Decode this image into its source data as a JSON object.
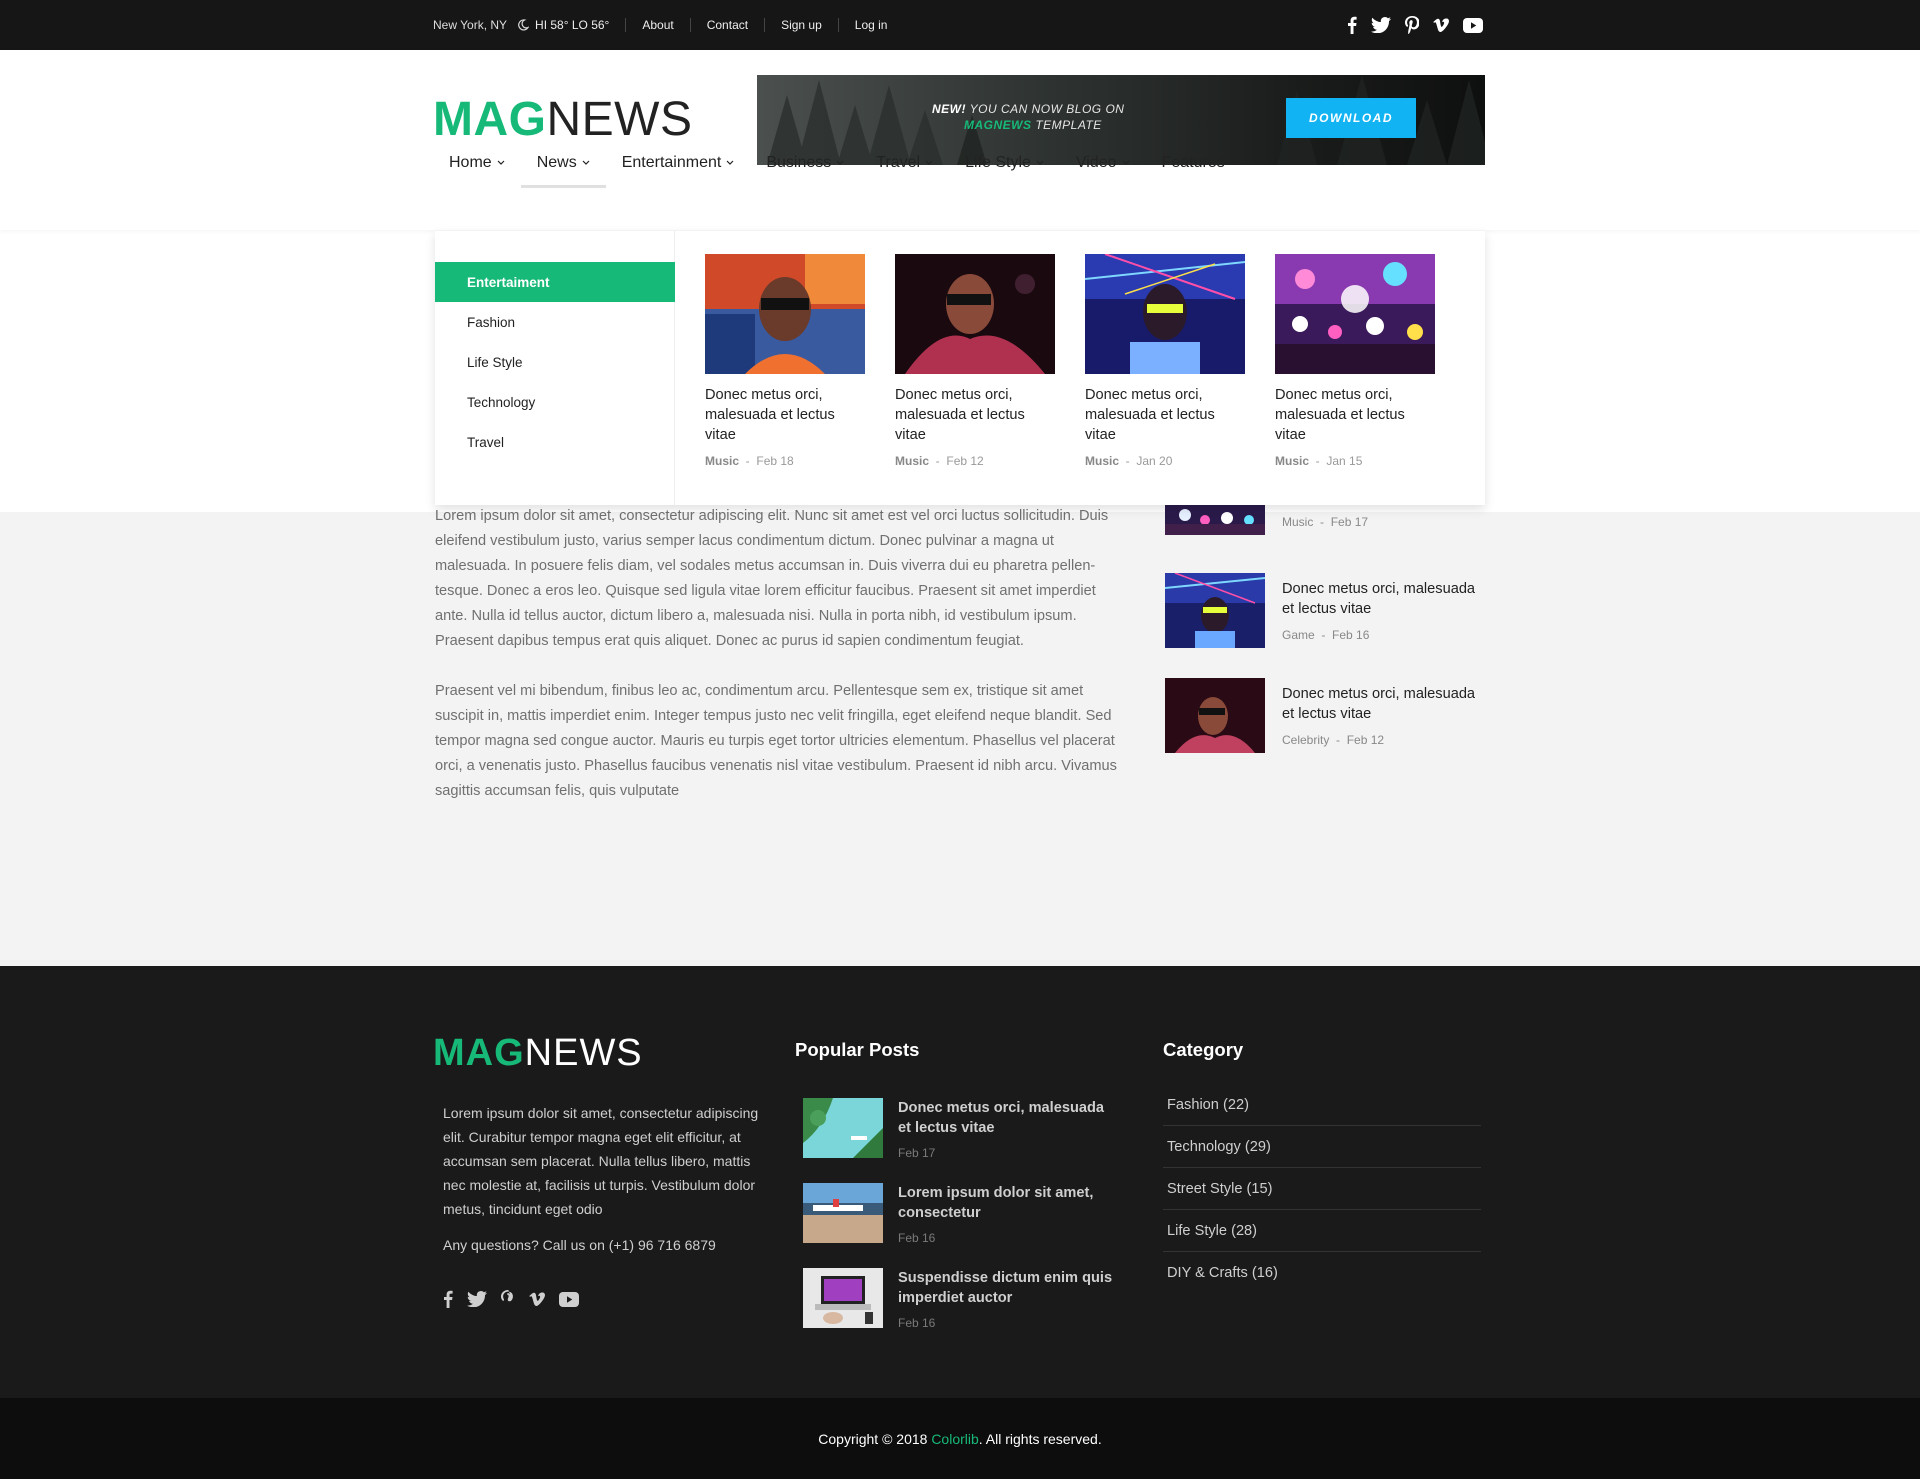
{
  "topbar": {
    "location": "New York, NY",
    "weather": "HI 58° LO 56°",
    "links": [
      "About",
      "Contact",
      "Sign up",
      "Log in"
    ],
    "social_icons": [
      "facebook-icon",
      "twitter-icon",
      "pinterest-icon",
      "vimeo-icon",
      "youtube-icon"
    ]
  },
  "header": {
    "logo_mag": "MAG",
    "logo_news": "NEWS",
    "banner": {
      "new": "NEW!",
      "line1": " YOU CAN NOW BLOG ON",
      "brand": "MAGNEWS",
      "line2": " TEMPLATE",
      "button": "DOWNLOAD"
    }
  },
  "nav": {
    "items": [
      "Home",
      "News",
      "Entertainment",
      "Business",
      "Travel",
      "Life Style",
      "Video",
      "Features"
    ],
    "active": "News"
  },
  "mega": {
    "categories": [
      "Entertaiment",
      "Fashion",
      "Life Style",
      "Technology",
      "Travel"
    ],
    "active_category": "Entertaiment",
    "cards": [
      {
        "title": "Donec metus orci, malesuada et lectus vitae",
        "category": "Music",
        "date": "Feb 18"
      },
      {
        "title": "Donec metus orci, malesuada et lectus vitae",
        "category": "Music",
        "date": "Feb 12"
      },
      {
        "title": "Donec metus orci, malesuada et lectus vitae",
        "category": "Music",
        "date": "Jan 20"
      },
      {
        "title": "Donec metus orci, malesuada et lectus vitae",
        "category": "Music",
        "date": "Jan 15"
      }
    ]
  },
  "article": {
    "paragraphs": [
      "Lorem ipsum dolor sit amet, consectetur adipiscing elit. Nunc sit amet est vel orci luctus sollicitudin. Duis eleifend vestibulum justo, varius semper lacus condimentum dictum. Donec pulvinar a magna ut malesuada. In posuere felis diam, vel sodales metus accumsan in. Duis viverra dui eu pharetra pellen-tesque. Donec a eros leo. Quisque sed ligula vitae lorem efficitur faucibus. Praesent sit amet imperdiet ante. Nulla id tellus auctor, dictum libero a, malesuada nisi. Nulla in porta nibh, id vestibulum ipsum. Praesent dapibus tempus erat quis aliquet. Donec ac purus id sapien condimentum feugiat.",
      "Praesent vel mi bibendum, finibus leo ac, condimentum arcu. Pellentesque sem ex, tristique sit amet suscipit in, mattis imperdiet enim. Integer tempus justo nec velit fringilla, eget eleifend neque blandit. Sed tempor magna sed congue auctor. Mauris eu turpis eget tortor ultricies elementum. Phasellus vel placerat orci, a venenatis justo. Phasellus faucibus venenatis nisl vitae vestibulum. Praesent id nibh arcu. Vivamus sagittis accumsan felis, quis vulputate"
    ]
  },
  "sidebar": {
    "items": [
      {
        "title": "",
        "category": "Music",
        "date": "Feb 17"
      },
      {
        "title": "Donec metus orci, malesuada et lectus vitae",
        "category": "Game",
        "date": "Feb 16"
      },
      {
        "title": "Donec metus orci, malesuada et lectus vitae",
        "category": "Celebrity",
        "date": "Feb 12"
      }
    ]
  },
  "footer": {
    "logo_mag": "MAG",
    "logo_news": "NEWS",
    "about": "Lorem ipsum dolor sit amet, consectetur adipiscing elit. Curabitur tempor magna eget elit efficitur, at accumsan sem placerat. Nulla tellus libero, mattis nec molestie at, facilisis ut turpis. Vestibulum dolor metus, tincidunt eget odio",
    "call": "Any questions? Call us on (+1) 96 716 6879",
    "popular_heading": "Popular Posts",
    "popular": [
      {
        "title": "Donec metus orci, malesuada et lectus vitae",
        "date": "Feb 17"
      },
      {
        "title": "Lorem ipsum dolor sit amet, consectetur",
        "date": "Feb 16"
      },
      {
        "title": "Suspendisse dictum enim quis imperdiet auctor",
        "date": "Feb 16"
      }
    ],
    "category_heading": "Category",
    "categories": [
      "Fashion (22)",
      "Technology (29)",
      "Street Style (15)",
      "Life Style (28)",
      "DIY & Crafts (16)"
    ]
  },
  "copyright": {
    "prefix": "Copyright © 2018 ",
    "brand": "Colorlib",
    "suffix": ". All rights reserved."
  },
  "colors": {
    "accent": "#17b978",
    "banner_button": "#11b3f2",
    "topbar": "#161616",
    "footer": "#1a1a1a"
  }
}
